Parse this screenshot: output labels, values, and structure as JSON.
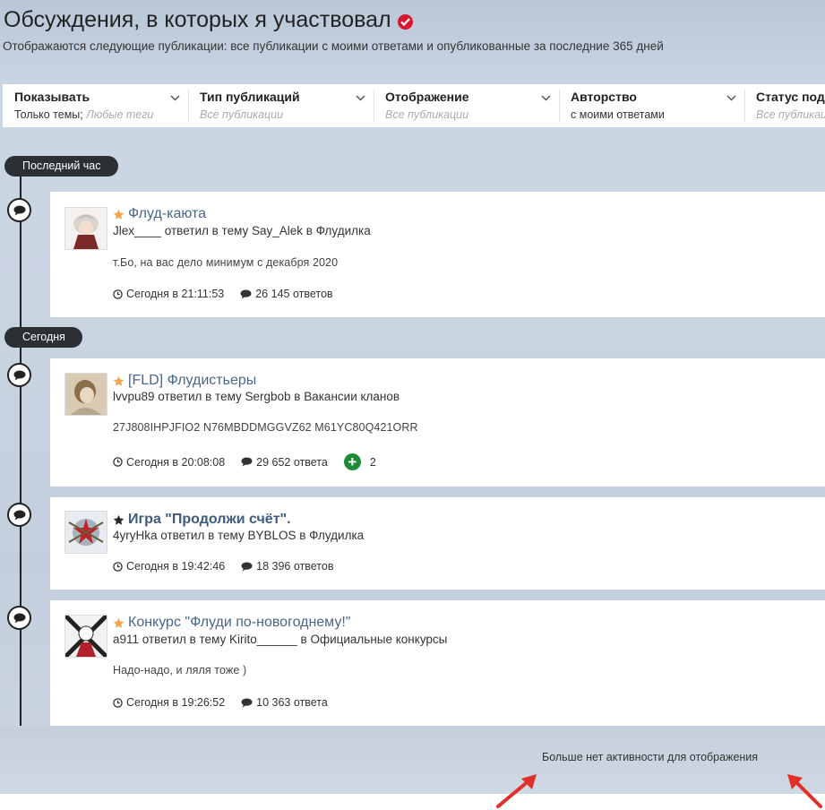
{
  "header": {
    "title": "Обсуждения, в которых я участвовал",
    "subtitle": "Отображаются следующие публикации: все публикации с моими ответами и опубликованные за последние 365 дней"
  },
  "filters": [
    {
      "label": "Показывать",
      "value": "Только темы;",
      "value_extra": "Любые теги"
    },
    {
      "label": "Тип публикаций",
      "value": "Все публикации"
    },
    {
      "label": "Отображение",
      "value": "Все публикации"
    },
    {
      "label": "Авторство",
      "value": "с моими ответами"
    },
    {
      "label": "Статус подписки",
      "value": "Все публикации"
    }
  ],
  "groups": {
    "last_hour": "Последний час",
    "today": "Сегодня"
  },
  "items": [
    {
      "title": "Флуд-каюта",
      "meta": "Jlex____ ответил в тему Say_Alek в Флудилка",
      "snippet": "т.Бо, на вас дело минимум с декабря 2020",
      "time": "Сегодня в 21:11:53",
      "replies": "26 145 ответов"
    },
    {
      "title": "[FLD] Флудистьеры",
      "meta": "lvvpu89 ответил в тему Sergbob в Вакансии кланов",
      "snippet": "27J808IHPJFIO2 N76MBDDMGGVZ62 M61YC80Q421ORR",
      "time": "Сегодня в 20:08:08",
      "replies": "29 652 ответа",
      "reactions": "2"
    },
    {
      "title": "Игра \"Продолжи счёт\".",
      "meta": "4yryHka ответил в тему BYBLOS в Флудилка",
      "time": "Сегодня в 19:42:46",
      "replies": "18 396 ответов"
    },
    {
      "title": "Конкурс \"Флуди по-новогоднему!\"",
      "meta": "a911 ответил в тему Kirito______ в Официальные конкурсы",
      "snippet": "Надо-надо, и ляля тоже )",
      "time": "Сегодня в 19:26:52",
      "replies": "10 363 ответа"
    }
  ],
  "footer": {
    "no_more": "Больше нет активности для отображения"
  },
  "colors": {
    "accent_link": "#4a6688",
    "star_gold": "#f0a54a",
    "reaction_green": "#1f8b3a",
    "verified_red": "#d9162f",
    "annotation_arrow": "#e0302a"
  }
}
